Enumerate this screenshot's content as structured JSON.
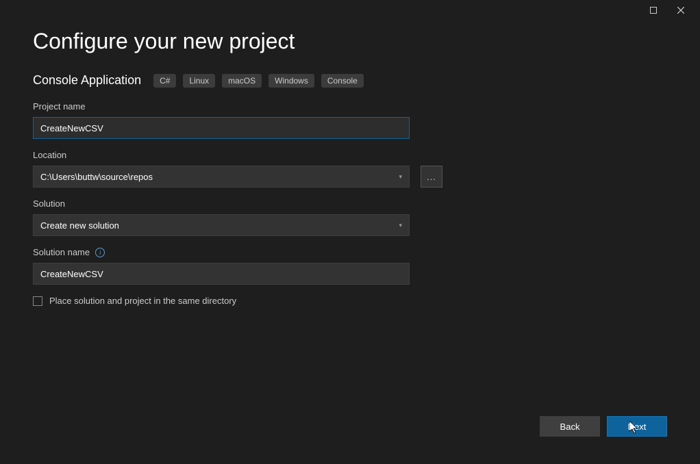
{
  "titlebar": {
    "maximize_name": "maximize",
    "close_name": "close"
  },
  "header": {
    "title": "Configure your new project"
  },
  "template": {
    "name": "Console Application",
    "tags": [
      "C#",
      "Linux",
      "macOS",
      "Windows",
      "Console"
    ]
  },
  "fields": {
    "projectName": {
      "label": "Project name",
      "value": "CreateNewCSV"
    },
    "location": {
      "label": "Location",
      "value": "C:\\Users\\buttw\\source\\repos",
      "browse": "..."
    },
    "solution": {
      "label": "Solution",
      "value": "Create new solution"
    },
    "solutionName": {
      "label": "Solution name",
      "value": "CreateNewCSV"
    },
    "sameDirectory": {
      "label": "Place solution and project in the same directory",
      "checked": false
    }
  },
  "buttons": {
    "back": "Back",
    "next": "Next"
  }
}
